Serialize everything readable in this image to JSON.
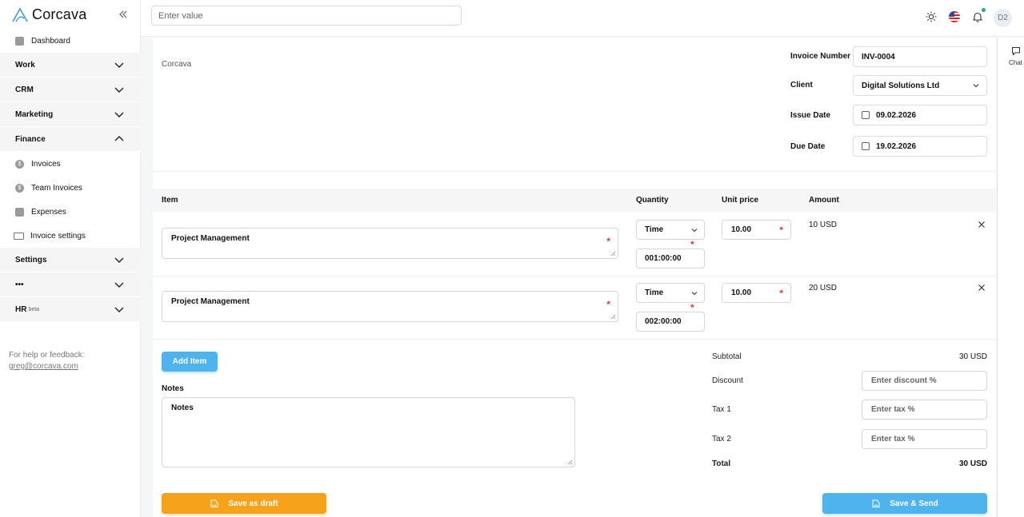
{
  "app": {
    "name": "Corcava",
    "user_initials": "D2"
  },
  "search": {
    "placeholder": "Enter value"
  },
  "sidebar": {
    "dashboard": "Dashboard",
    "groups": {
      "work": "Work",
      "crm": "CRM",
      "marketing": "Marketing",
      "finance": "Finance",
      "settings": "Settings",
      "more": "•••",
      "hr": "HR",
      "hr_badge": "beta"
    },
    "finance_items": [
      "Invoices",
      "Team Invoices",
      "Expenses",
      "Invoice settings"
    ],
    "help_text": "For help or feedback:",
    "help_email": "greg@corcava.com"
  },
  "invoice": {
    "company": "Corcava",
    "number_label": "Invoice Number",
    "number": "INV-0004",
    "client_label": "Client",
    "client": "Digital Solutions Ltd",
    "issue_label": "Issue Date",
    "issue_date": "09.02.2026",
    "due_label": "Due Date",
    "due_date": "19.02.2026"
  },
  "table": {
    "headers": {
      "item": "Item",
      "quantity": "Quantity",
      "unit_price": "Unit price",
      "amount": "Amount"
    },
    "rows": [
      {
        "item": "Project Management",
        "qty_type": "Time",
        "qty_value": "001:00:00",
        "price": "10.00",
        "amount": "10 USD"
      },
      {
        "item": "Project Management",
        "qty_type": "Time",
        "qty_value": "002:00:00",
        "price": "10.00",
        "amount": "20 USD"
      }
    ]
  },
  "actions": {
    "add_item": "Add Item",
    "save_draft": "Save as draft",
    "save_send": "Save & Send"
  },
  "notes": {
    "label": "Notes",
    "value": "Notes"
  },
  "summary": {
    "subtotal_label": "Subtotal",
    "subtotal": "30 USD",
    "discount_label": "Discount",
    "discount_placeholder": "Enter discount %",
    "tax1_label": "Tax 1",
    "tax1_placeholder": "Enter tax %",
    "tax2_label": "Tax 2",
    "tax2_placeholder": "Enter tax %",
    "total_label": "Total",
    "total": "30 USD"
  },
  "chat": {
    "label": "Chat"
  },
  "colors": {
    "primary": "#4fb3ee",
    "draft": "#f7a21b",
    "required": "#e53935"
  }
}
